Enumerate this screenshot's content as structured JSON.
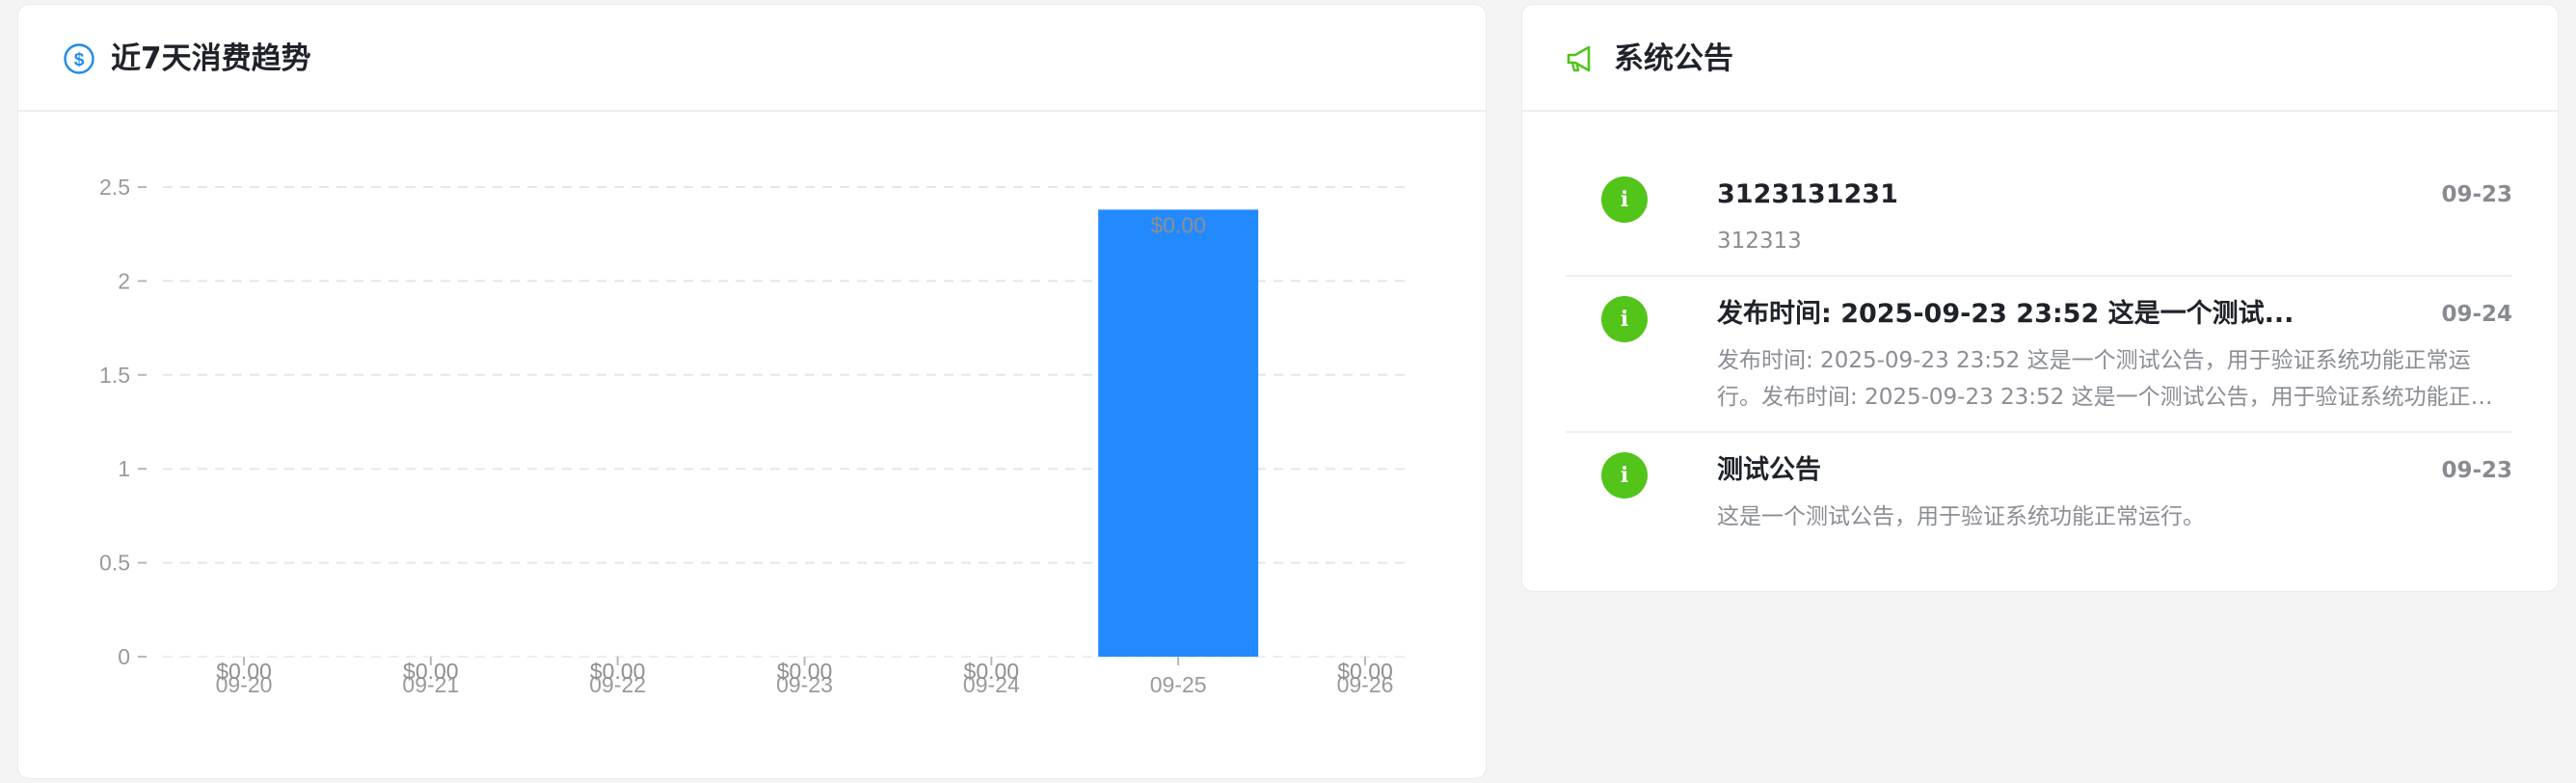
{
  "chart_panel": {
    "title": "近7天消费趋势",
    "icon": "dollar-circle-icon",
    "accent": "#1f8bea"
  },
  "chart_data": {
    "type": "bar",
    "categories": [
      "09-20",
      "09-21",
      "09-22",
      "09-23",
      "09-24",
      "09-25",
      "09-26"
    ],
    "values": [
      0,
      0,
      0,
      0,
      0,
      2.38,
      0
    ],
    "data_labels": [
      "$0.00",
      "$0.00",
      "$0.00",
      "$0.00",
      "$0.00",
      "$0.00",
      "$0.00"
    ],
    "y_ticks": [
      "0",
      "0.5",
      "1",
      "1.5",
      "2",
      "2.5"
    ],
    "ylim": [
      0,
      2.5
    ],
    "grid": true,
    "bar_color": "#2389ff"
  },
  "notice_panel": {
    "title": "系统公告",
    "icon": "megaphone-icon",
    "accent": "#52c41a",
    "items": [
      {
        "icon": "info-icon",
        "title": "3123131231",
        "date": "09-23",
        "description": "312313"
      },
      {
        "icon": "info-icon",
        "title": "发布时间: 2025-09-23 23:52 这是一个测试...",
        "date": "09-24",
        "description": "发布时间: 2025-09-23 23:52 这是一个测试公告，用于验证系统功能正常运行。发布时间: 2025-09-23 23:52 这是一个测试公告，用于验证系统功能正常运行。"
      },
      {
        "icon": "info-icon",
        "title": "测试公告",
        "date": "09-23",
        "description": "这是一个测试公告，用于验证系统功能正常运行。"
      }
    ]
  }
}
